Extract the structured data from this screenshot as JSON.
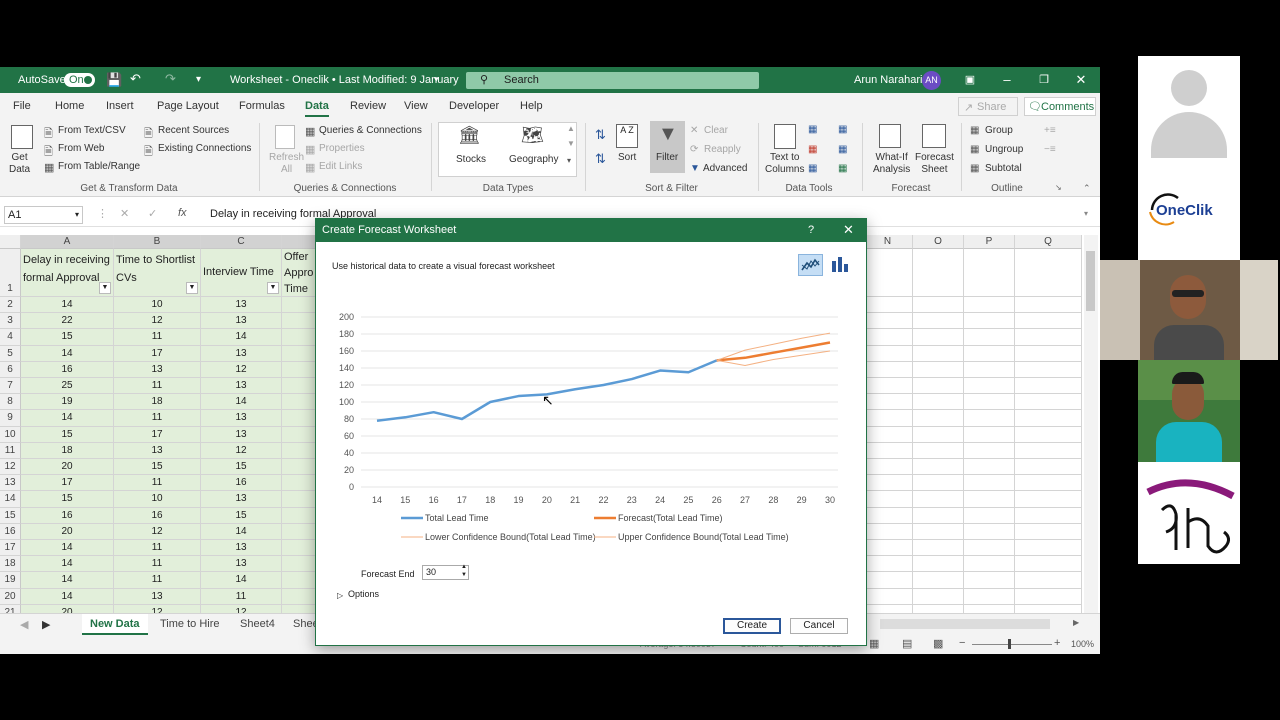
{
  "titlebar": {
    "autosave_label": "AutoSave",
    "autosave_state": "On",
    "doc_title": "Worksheet - Oneclik  •  Last Modified: 9 January",
    "search_placeholder": "Search",
    "user_name": "Arun Narahari",
    "user_initials": "AN"
  },
  "menu": {
    "items": [
      "File",
      "Home",
      "Insert",
      "Page Layout",
      "Formulas",
      "Data",
      "Review",
      "View",
      "Developer",
      "Help"
    ],
    "active": "Data",
    "share": "Share",
    "comments": "Comments"
  },
  "ribbon": {
    "get_data": "Get\nData",
    "from_text": "From Text/CSV",
    "from_web": "From Web",
    "from_table": "From Table/Range",
    "recent_sources": "Recent Sources",
    "existing_connections": "Existing Connections",
    "group_get_transform": "Get & Transform Data",
    "refresh_all": "Refresh\nAll",
    "queries_connections": "Queries & Connections",
    "properties": "Properties",
    "edit_links": "Edit Links",
    "group_queries": "Queries & Connections",
    "stocks": "Stocks",
    "geography": "Geography",
    "group_data_types": "Data Types",
    "sort": "Sort",
    "filter": "Filter",
    "clear": "Clear",
    "reapply": "Reapply",
    "advanced": "Advanced",
    "group_sort_filter": "Sort & Filter",
    "text_to_columns": "Text to\nColumns",
    "group_data_tools": "Data Tools",
    "what_if": "What-If\nAnalysis",
    "forecast_sheet": "Forecast\nSheet",
    "group_forecast": "Forecast",
    "group": "Group",
    "ungroup": "Ungroup",
    "subtotal": "Subtotal",
    "group_outline": "Outline"
  },
  "formula_bar": {
    "name_box": "A1",
    "fx": "fx",
    "content": "Delay in receiving formal Approval"
  },
  "sheet": {
    "columns_left": [
      "A",
      "B",
      "C"
    ],
    "columns_right": [
      "N",
      "O",
      "P",
      "Q"
    ],
    "headers": [
      "Delay in receiving formal Approval",
      "Time to Shortlist CVs",
      "Interview Time",
      "Offer Appro Time"
    ],
    "rows": [
      [
        "2",
        "14",
        "10",
        "13"
      ],
      [
        "3",
        "22",
        "12",
        "13"
      ],
      [
        "4",
        "15",
        "11",
        "14"
      ],
      [
        "5",
        "14",
        "17",
        "13"
      ],
      [
        "6",
        "16",
        "13",
        "12"
      ],
      [
        "7",
        "25",
        "11",
        "13"
      ],
      [
        "8",
        "19",
        "18",
        "14"
      ],
      [
        "9",
        "14",
        "11",
        "13"
      ],
      [
        "10",
        "15",
        "17",
        "13"
      ],
      [
        "11",
        "18",
        "13",
        "12"
      ],
      [
        "12",
        "20",
        "15",
        "15"
      ],
      [
        "13",
        "17",
        "11",
        "16"
      ],
      [
        "14",
        "15",
        "10",
        "13"
      ],
      [
        "15",
        "16",
        "16",
        "15"
      ],
      [
        "16",
        "20",
        "12",
        "14"
      ],
      [
        "17",
        "14",
        "11",
        "13"
      ],
      [
        "18",
        "14",
        "11",
        "13"
      ],
      [
        "19",
        "14",
        "11",
        "14"
      ],
      [
        "20",
        "14",
        "13",
        "11"
      ],
      [
        "21",
        "20",
        "12",
        "12"
      ]
    ],
    "tabs": [
      "New Data",
      "Time to Hire",
      "Sheet4",
      "Shee"
    ],
    "active_tab": "New Data",
    "status": {
      "average": "Average: 54.80037",
      "count": "Count: 400",
      "sum": "Sum: 9912",
      "zoom": "100%"
    }
  },
  "dialog": {
    "title": "Create Forecast Worksheet",
    "help": "?",
    "description": "Use historical data to create a visual forecast worksheet",
    "forecast_end_label": "Forecast End",
    "forecast_end_value": "30",
    "options_label": "Options",
    "create_label": "Create",
    "cancel_label": "Cancel"
  },
  "chart_data": {
    "type": "line",
    "x": [
      14,
      15,
      16,
      17,
      18,
      19,
      20,
      21,
      22,
      23,
      24,
      25,
      26,
      27,
      28,
      29,
      30
    ],
    "ylim": [
      0,
      200
    ],
    "yticks": [
      0,
      20,
      40,
      60,
      80,
      100,
      120,
      140,
      160,
      180,
      200
    ],
    "grid": true,
    "legend_position": "bottom",
    "series": [
      {
        "name": "Total Lead Time",
        "x": [
          14,
          15,
          16,
          17,
          18,
          19,
          20,
          21,
          22,
          23,
          24,
          25,
          26
        ],
        "values": [
          78,
          82,
          88,
          80,
          100,
          107,
          109,
          115,
          120,
          127,
          137,
          135,
          149
        ],
        "color": "#5b9bd5",
        "width": 2.5
      },
      {
        "name": "Forecast(Total Lead Time)",
        "x": [
          26,
          27,
          28,
          29,
          30
        ],
        "values": [
          149,
          152,
          158,
          164,
          170
        ],
        "color": "#ed7d31",
        "width": 2.5
      },
      {
        "name": "Lower Confidence Bound(Total Lead Time)",
        "x": [
          26,
          27,
          28,
          29,
          30
        ],
        "values": [
          149,
          143,
          150,
          155,
          160
        ],
        "color": "#f4b183",
        "width": 1
      },
      {
        "name": "Upper Confidence Bound(Total Lead Time)",
        "x": [
          26,
          27,
          28,
          29,
          30
        ],
        "values": [
          149,
          161,
          168,
          175,
          181
        ],
        "color": "#f4b183",
        "width": 1
      }
    ]
  },
  "participants": {
    "logo_text": "OneClik"
  }
}
